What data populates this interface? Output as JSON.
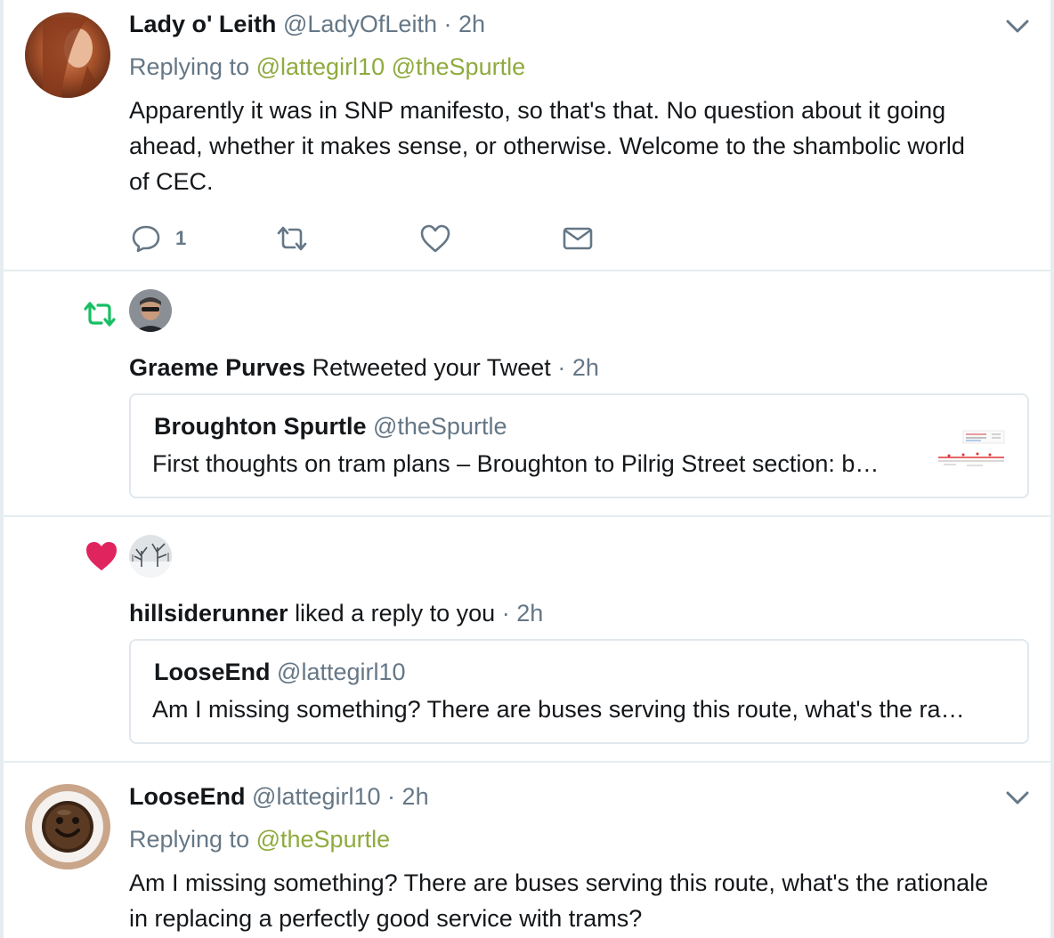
{
  "colors": {
    "text": "#14171a",
    "muted": "#657786",
    "mention": "#8faa3e",
    "retweet": "#17bf63",
    "like": "#e0245e",
    "border": "#e6ecf0"
  },
  "tweet1": {
    "name": "Lady o' Leith",
    "handle": "@LadyOfLeith",
    "separator": "·",
    "time": "2h",
    "replying_to": "Replying to",
    "mentions": [
      "@lattegirl10",
      "@theSpurtle"
    ],
    "text_lines": [
      "Apparently it was in SNP manifesto, so that's that. No question about it going",
      "ahead, whether it makes sense, or otherwise. Welcome to the shambolic world",
      "of CEC."
    ],
    "reply_count": "1",
    "icons": [
      "reply-icon",
      "retweet-icon",
      "like-icon",
      "message-icon",
      "chevron-down-icon"
    ]
  },
  "notif_retweet": {
    "icon": "retweet-icon",
    "user": "Graeme Purves",
    "action": "Retweeted your Tweet",
    "separator": "·",
    "time": "2h",
    "card": {
      "name": "Broughton Spurtle",
      "handle": "@theSpurtle",
      "text": "First thoughts on tram plans – Broughton to Pilrig Street section: b…"
    }
  },
  "notif_like": {
    "icon": "heart-icon",
    "user": "hillsiderunner",
    "action": "liked a reply to you",
    "separator": "·",
    "time": "2h",
    "card": {
      "name": "LooseEnd",
      "handle": "@lattegirl10",
      "text": "Am I missing something? There are buses serving this route, what's the ra…"
    }
  },
  "tweet2": {
    "name": "LooseEnd",
    "handle": "@lattegirl10",
    "separator": "·",
    "time": "2h",
    "replying_to": "Replying to",
    "mentions": [
      "@theSpurtle"
    ],
    "text_lines": [
      "Am I missing something? There are buses serving this route, what's the rationale",
      "in replacing a perfectly good service with trams?"
    ]
  }
}
